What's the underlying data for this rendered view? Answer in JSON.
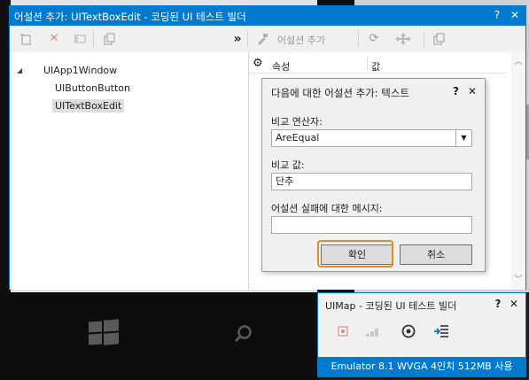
{
  "main_window": {
    "title": "어설션 추가: UITextBoxEdit - 코딩된 UI 테스트 빌더",
    "help_glyph": "?",
    "close_glyph": "✕"
  },
  "toolbar": {
    "expand_glyph": "»",
    "add_assertion_label": "어설션 추가"
  },
  "tree": {
    "items": [
      {
        "label": "UIApp1Window",
        "expanded": true
      },
      {
        "label": "UIButtonButton"
      },
      {
        "label": "UITextBoxEdit",
        "selected": true
      }
    ]
  },
  "grid": {
    "columns": [
      "속성",
      "값"
    ]
  },
  "dialog": {
    "title": "다음에 대한 어설션 추가: 텍스트",
    "help_glyph": "?",
    "close_glyph": "✕",
    "comparator_label": "비교 연산자:",
    "comparator_value": "AreEqual",
    "compare_value_label": "비교 값:",
    "compare_value": "단추",
    "failure_message_label": "어설션 실패에 대한 메시지:",
    "failure_message_value": "",
    "ok_label": "확인",
    "cancel_label": "취소"
  },
  "uimap_window": {
    "title": "UIMap - 코딩된 UI 테스트 빌더",
    "help_glyph": "?",
    "close_glyph": "✕",
    "status": "Emulator 8.1 WVGA 4인치 512MB 사용"
  },
  "colors": {
    "accent": "#007acc",
    "focus": "#ea8a1e",
    "record_icon": "#e06060"
  }
}
